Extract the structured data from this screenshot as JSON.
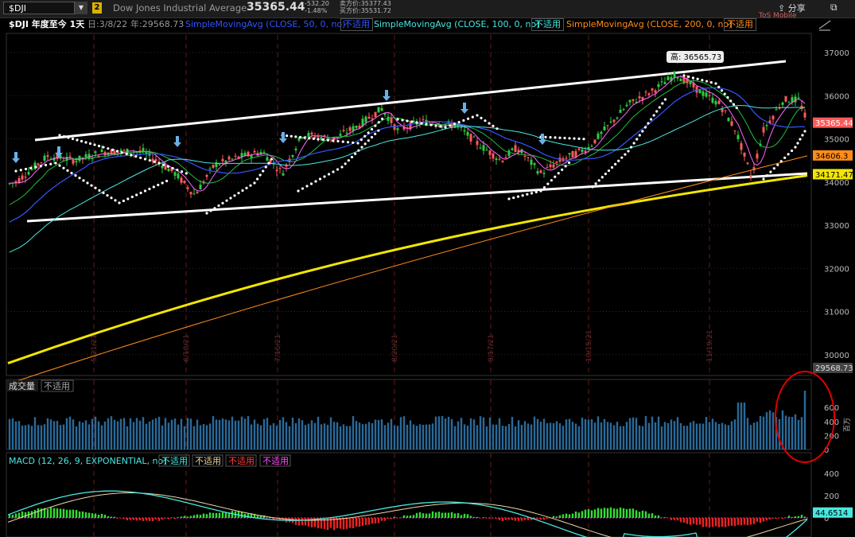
{
  "header": {
    "symbol": "$DJI",
    "link_number": "2",
    "instrument_name": "Dow Jones Industrial Average",
    "last_price": "35365.44",
    "net_change": "-532.20",
    "pct_change": "-1.48%",
    "ask_label": "卖方价:35377.43",
    "bid_label": "买方价:35531.72",
    "share_label": "分享",
    "partial_corner_text": "ToS Mobile"
  },
  "price_panel": {
    "title": "$DJI 年度至今 1天",
    "date_label": "日:3/8/22",
    "level_label": "年:29568.73",
    "studies": [
      {
        "label": "SimpleMovingAvg (CLOSE, 50, 0, no)",
        "status": "不适用",
        "color": "#3355ff"
      },
      {
        "label": "SimpleMovingAvg (CLOSE, 100, 0, no)",
        "status": "不适用",
        "color": "#48e8e0"
      },
      {
        "label": "SimpleMovingAvg (CLOSE, 200, 0, no)",
        "status": "不适用",
        "color": "#ff8c1a"
      }
    ],
    "high_label": "高: 36565.73",
    "price_tag_last": "35365.44",
    "price_tag_ma100": "34606.3",
    "price_tag_ma200": "34171.47",
    "price_tag_low": "29568.73",
    "y_ticks": [
      {
        "value": 37000,
        "label": "37000"
      },
      {
        "value": 36000,
        "label": "36000"
      },
      {
        "value": 35000,
        "label": "35000"
      },
      {
        "value": 34000,
        "label": "34000"
      },
      {
        "value": 33000,
        "label": "33000"
      },
      {
        "value": 32000,
        "label": "32000"
      },
      {
        "value": 31000,
        "label": "31000"
      },
      {
        "value": 30000,
        "label": "30000"
      }
    ],
    "date_markers": [
      "5/21/21",
      "6/18/21",
      "7/16/21",
      "8/20/21",
      "9/17/21",
      "10/15/21",
      "11/19/21"
    ]
  },
  "volume_panel": {
    "title": "成交量",
    "status": "不适用",
    "unit_label": "百万",
    "y_ticks": [
      "600",
      "400",
      "200",
      "0"
    ]
  },
  "macd_panel": {
    "title": "MACD (12, 26, 9, EXPONENTIAL, no)",
    "statuses": [
      {
        "text": "不适用",
        "color": "#48e8e0"
      },
      {
        "text": "不适用",
        "color": "#e8d8a0"
      },
      {
        "text": "不适用",
        "color": "#ff4040"
      },
      {
        "text": "不适用",
        "color": "#ff50ff"
      }
    ],
    "y_ticks": [
      "400",
      "200",
      "0"
    ],
    "value_tag": "44.6514"
  },
  "colors": {
    "background": "#000000",
    "grid": "#2a2a2a",
    "up_candle": "#2ecc40",
    "down_candle": "#ff5a5a",
    "ma20": "#ff66ff",
    "ma50": "#3355ff",
    "ma100": "#48e8e0",
    "ma200_thick": "#f2e600",
    "ma200_thin": "#ff8c1a",
    "volume": "#2a6a9a",
    "macd_line": "#48e8e0",
    "signal_line": "#f0d8a0",
    "hist_up": "#33dd33",
    "hist_down": "#ee2222",
    "annotation_circle": "#e00000",
    "trendline": "#ffffff",
    "arrow": "#6ab0e8"
  }
}
